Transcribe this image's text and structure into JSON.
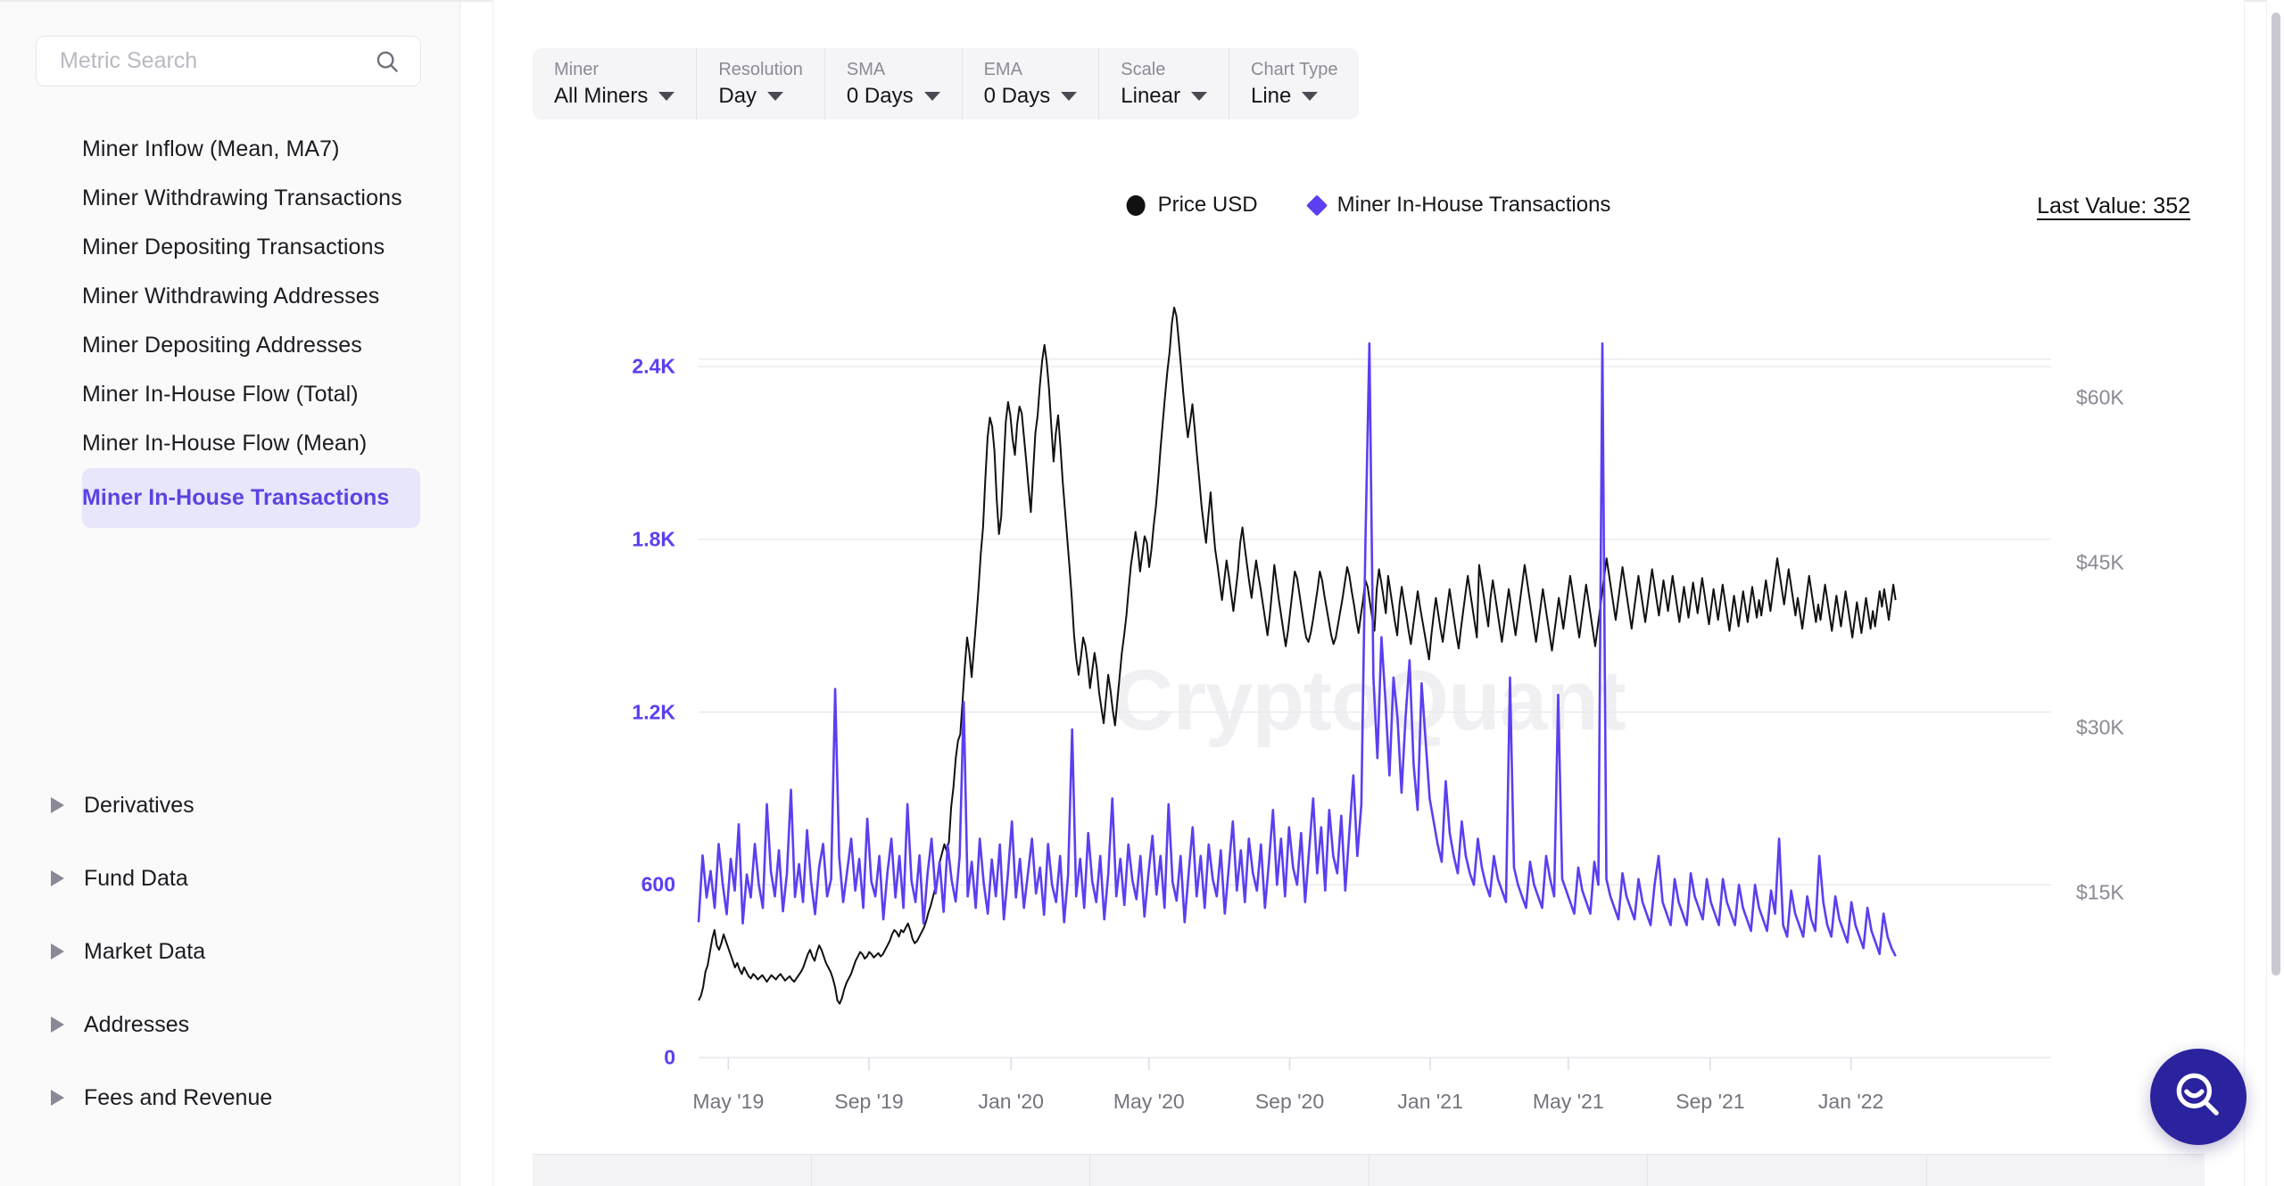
{
  "sidebar": {
    "search": {
      "placeholder": "Metric Search",
      "value": "",
      "icon": "search-icon"
    },
    "metrics": [
      {
        "label": "Miner Inflow (Mean, MA7)",
        "selected": false
      },
      {
        "label": "Miner Withdrawing Transactions",
        "selected": false
      },
      {
        "label": "Miner Depositing Transactions",
        "selected": false
      },
      {
        "label": "Miner Withdrawing Addresses",
        "selected": false
      },
      {
        "label": "Miner Depositing Addresses",
        "selected": false
      },
      {
        "label": "Miner In-House Flow (Total)",
        "selected": false
      },
      {
        "label": "Miner In-House Flow (Mean)",
        "selected": false
      },
      {
        "label": "Miner In-House Transactions",
        "selected": true
      }
    ],
    "groups": [
      {
        "label": "Derivatives",
        "icon": "caret-right-icon",
        "expanded": false
      },
      {
        "label": "Fund Data",
        "icon": "caret-right-icon",
        "expanded": false
      },
      {
        "label": "Market Data",
        "icon": "caret-right-icon",
        "expanded": false
      },
      {
        "label": "Addresses",
        "icon": "caret-right-icon",
        "expanded": false
      },
      {
        "label": "Fees and Revenue",
        "icon": "caret-right-icon",
        "expanded": false
      }
    ],
    "selected_color": "#5a43e3",
    "selected_bg": "#e8e6fb"
  },
  "controls": [
    {
      "label": "Miner",
      "value": "All Miners",
      "icon": "chevron-down-icon"
    },
    {
      "label": "Resolution",
      "value": "Day",
      "icon": "chevron-down-icon"
    },
    {
      "label": "SMA",
      "value": "0 Days",
      "icon": "chevron-down-icon"
    },
    {
      "label": "EMA",
      "value": "0 Days",
      "icon": "chevron-down-icon"
    },
    {
      "label": "Scale",
      "value": "Linear",
      "icon": "chevron-down-icon"
    },
    {
      "label": "Chart Type",
      "value": "Line",
      "icon": "chevron-down-icon"
    }
  ],
  "legend": {
    "entries": [
      {
        "label": "Price USD",
        "marker": "circle",
        "color": "#111114"
      },
      {
        "label": "Miner In-House Transactions",
        "marker": "diamond",
        "color": "#5b3ff0"
      }
    ],
    "last_value": "Last Value: 352"
  },
  "watermark": "CryptoQuant",
  "fab": {
    "icon": "search-smile-icon",
    "color": "#2b229e"
  },
  "chart_data": {
    "type": "line",
    "title": "",
    "subtitle": "",
    "xlabel": "",
    "grid": true,
    "legend_position": "top-center",
    "x_ticks": [
      "May '19",
      "Sep '19",
      "Jan '20",
      "May '20",
      "Sep '20",
      "Jan '21",
      "May '21",
      "Sep '21",
      "Jan '22"
    ],
    "x_tick_positions": [
      0.022,
      0.126,
      0.231,
      0.333,
      0.437,
      0.541,
      0.643,
      0.748,
      0.852
    ],
    "axes": {
      "left": {
        "label": "Miner In-House Transactions",
        "color": "#5b3ff0",
        "ticks": [
          "0",
          "600",
          "1.2K",
          "1.8K",
          "2.4K"
        ],
        "tick_values": [
          0,
          600,
          1200,
          1800,
          2400
        ],
        "ylim": [
          0,
          2750
        ]
      },
      "right": {
        "label": "Price USD",
        "color": "#8a8a96",
        "ticks": [
          "$15K",
          "$30K",
          "$45K",
          "$60K"
        ],
        "tick_values": [
          15000,
          30000,
          45000,
          60000
        ],
        "ylim": [
          0,
          72000
        ]
      }
    },
    "series": [
      {
        "name": "Miner In-House Transactions",
        "color": "#5b3ff0",
        "axis": "left",
        "values": [
          470,
          702,
          556,
          648,
          520,
          742,
          604,
          498,
          690,
          580,
          810,
          466,
          636,
          556,
          742,
          600,
          520,
          880,
          646,
          560,
          720,
          508,
          640,
          930,
          558,
          672,
          540,
          790,
          612,
          498,
          660,
          742,
          560,
          620,
          1280,
          700,
          540,
          648,
          760,
          580,
          690,
          520,
          830,
          612,
          560,
          700,
          480,
          640,
          760,
          556,
          700,
          520,
          880,
          614,
          540,
          702,
          466,
          638,
          760,
          570,
          680,
          506,
          740,
          616,
          542,
          700,
          1235,
          560,
          680,
          520,
          760,
          604,
          500,
          688,
          560,
          740,
          480,
          636,
          820,
          556,
          690,
          520,
          640,
          760,
          570,
          660,
          496,
          742,
          600,
          540,
          700,
          470,
          636,
          1140,
          560,
          690,
          520,
          780,
          612,
          540,
          700,
          480,
          640,
          900,
          560,
          690,
          530,
          740,
          616,
          550,
          700,
          490,
          640,
          770,
          566,
          700,
          520,
          880,
          610,
          545,
          700,
          470,
          640,
          800,
          560,
          700,
          520,
          740,
          620,
          560,
          720,
          500,
          660,
          820,
          580,
          720,
          540,
          760,
          640,
          580,
          740,
          520,
          680,
          860,
          600,
          760,
          560,
          800,
          660,
          600,
          780,
          540,
          720,
          900,
          640,
          800,
          580,
          860,
          700,
          640,
          840,
          580,
          780,
          980,
          700,
          880,
          1780,
          2480,
          1320,
          1040,
          1460,
          1240,
          980,
          1320,
          1180,
          920,
          1180,
          1380,
          1020,
          860,
          1300,
          1100,
          900,
          820,
          740,
          680,
          960,
          780,
          700,
          640,
          820,
          700,
          640,
          600,
          760,
          660,
          600,
          560,
          700,
          620,
          580,
          540,
          1320,
          660,
          600,
          560,
          520,
          680,
          600,
          560,
          520,
          700,
          620,
          560,
          1260,
          620,
          580,
          540,
          500,
          660,
          580,
          540,
          500,
          680,
          600,
          2480,
          620,
          560,
          520,
          480,
          640,
          560,
          520,
          480,
          620,
          540,
          500,
          460,
          600,
          700,
          540,
          500,
          460,
          620,
          540,
          500,
          460,
          640,
          560,
          520,
          480,
          620,
          540,
          500,
          460,
          620,
          540,
          500,
          460,
          600,
          520,
          480,
          440,
          600,
          520,
          480,
          440,
          580,
          500,
          760,
          460,
          420,
          580,
          500,
          460,
          420,
          560,
          480,
          440,
          700,
          540,
          460,
          420,
          560,
          480,
          440,
          400,
          540,
          460,
          420,
          380,
          520,
          440,
          400,
          360,
          500,
          420,
          380,
          352
        ]
      },
      {
        "name": "Price USD",
        "color": "#111114",
        "axis": "right",
        "values": [
          5200,
          5600,
          6400,
          7800,
          8400,
          9600,
          10800,
          11600,
          10200,
          9800,
          10400,
          11200,
          10600,
          10000,
          9400,
          8800,
          8200,
          8600,
          8000,
          7600,
          8200,
          7800,
          7400,
          7200,
          7600,
          7400,
          7100,
          7300,
          7500,
          7200,
          6900,
          7200,
          7500,
          7300,
          7100,
          7400,
          7600,
          7300,
          7000,
          7200,
          7400,
          7100,
          6900,
          7200,
          7500,
          7800,
          8200,
          8800,
          9400,
          9800,
          9200,
          8800,
          9600,
          10200,
          9800,
          9200,
          8600,
          8200,
          7800,
          7200,
          6400,
          5200,
          4900,
          5400,
          6200,
          6800,
          7200,
          7600,
          8200,
          8800,
          9200,
          9600,
          9400,
          9000,
          9200,
          9600,
          9400,
          9100,
          9300,
          9500,
          9200,
          9400,
          9800,
          10200,
          10600,
          11200,
          11600,
          11400,
          11000,
          11600,
          11400,
          11800,
          12200,
          11600,
          10800,
          10400,
          10600,
          11000,
          11400,
          11800,
          12400,
          13200,
          13800,
          14600,
          15400,
          16200,
          17800,
          18600,
          19400,
          18800,
          19600,
          22800,
          24600,
          27200,
          28800,
          29400,
          32400,
          35600,
          38200,
          36800,
          34600,
          37200,
          39800,
          42600,
          45800,
          48200,
          52600,
          56400,
          58200,
          57400,
          55200,
          50800,
          47600,
          49200,
          53600,
          57800,
          59600,
          58400,
          56200,
          54800,
          57600,
          59200,
          58600,
          56400,
          54200,
          51800,
          49600,
          53200,
          56800,
          58400,
          61200,
          63400,
          64800,
          63200,
          60800,
          57400,
          54200,
          56800,
          58400,
          55600,
          52400,
          49800,
          47200,
          44600,
          41800,
          38400,
          36200,
          34800,
          36400,
          38200,
          37400,
          35800,
          33600,
          35200,
          36800,
          35400,
          33200,
          31800,
          30400,
          32600,
          34800,
          33400,
          31600,
          30200,
          32400,
          34600,
          36800,
          38400,
          40200,
          42600,
          44800,
          46200,
          47800,
          46400,
          44200,
          45800,
          47400,
          46800,
          44600,
          46200,
          48400,
          50200,
          52600,
          55400,
          57800,
          60200,
          62400,
          64200,
          66800,
          68200,
          67400,
          65200,
          62800,
          60400,
          58200,
          56400,
          57800,
          59400,
          57200,
          54800,
          52600,
          50200,
          48400,
          46800,
          49200,
          51400,
          48600,
          46200,
          44800,
          43200,
          41600,
          43400,
          45200,
          43800,
          42200,
          40600,
          42400,
          44200,
          46800,
          48200,
          46400,
          44800,
          43200,
          41800,
          43600,
          45200,
          43800,
          42600,
          41200,
          39800,
          38400,
          40200,
          42400,
          44800,
          43200,
          41600,
          40200,
          38800,
          37400,
          38800,
          40600,
          42400,
          44200,
          43600,
          42200,
          40800,
          39400,
          38200,
          37800,
          38600,
          39800,
          41200,
          42600,
          44200,
          43400,
          42000,
          40800,
          39600,
          38400,
          37600,
          38200,
          39400,
          40600,
          41800,
          43200,
          44600,
          43800,
          42400,
          41200,
          39800,
          38600,
          40200,
          41600,
          43400,
          42800,
          41400,
          40000,
          38800,
          42600,
          44400,
          43200,
          41800,
          40400,
          43800,
          42400,
          41000,
          39600,
          38400,
          41200,
          42800,
          41400,
          40200,
          38800,
          37600,
          39200,
          40800,
          42400,
          41000,
          39800,
          38600,
          37400,
          36200,
          38400,
          40200,
          41800,
          40400,
          39000,
          37800,
          39400,
          41000,
          42600,
          41200,
          39800,
          38400,
          37200,
          39000,
          40600,
          42200,
          43800,
          42400,
          41000,
          39600,
          38200,
          44800,
          43400,
          42000,
          40600,
          39200,
          41800,
          43400,
          42000,
          40600,
          39200,
          37800,
          39400,
          41000,
          42600,
          41200,
          39800,
          38400,
          40000,
          41600,
          43200,
          44800,
          43400,
          42000,
          40600,
          39200,
          37800,
          39400,
          41000,
          42600,
          41200,
          39800,
          38400,
          37000,
          38600,
          40200,
          41800,
          40400,
          39000,
          40600,
          42200,
          43800,
          42400,
          41000,
          39600,
          38200,
          39800,
          41400,
          43000,
          41600,
          40200,
          38800,
          37400,
          39000,
          40600,
          42200,
          43800,
          45400,
          44000,
          42600,
          41200,
          39800,
          41400,
          43000,
          44600,
          43200,
          41800,
          40400,
          39000,
          40600,
          42200,
          43800,
          42400,
          41000,
          39600,
          41200,
          42800,
          44400,
          43000,
          41600,
          40200,
          41800,
          43400,
          42000,
          40600,
          42200,
          43800,
          42400,
          41000,
          39600,
          41200,
          42800,
          41400,
          40000,
          41600,
          43200,
          41800,
          40400,
          42000,
          43600,
          42200,
          40800,
          39400,
          41000,
          42600,
          41200,
          39800,
          41400,
          43000,
          41600,
          40200,
          38800,
          40400,
          42000,
          40600,
          39200,
          40800,
          42400,
          41000,
          39600,
          41200,
          42800,
          41400,
          40000,
          41600,
          40200,
          41800,
          43400,
          42000,
          40600,
          42200,
          43800,
          45400,
          44000,
          42600,
          41200,
          42800,
          44400,
          43000,
          41600,
          40200,
          41800,
          40400,
          39000,
          40600,
          42200,
          43800,
          42400,
          41000,
          39600,
          41200,
          39800,
          41400,
          43000,
          41600,
          40200,
          38800,
          40400,
          42000,
          40600,
          39200,
          40800,
          42400,
          41000,
          39600,
          38200,
          39800,
          41400,
          40000,
          38600,
          40200,
          41800,
          40400,
          39000,
          40600,
          39200,
          40800,
          42400,
          41000,
          42600,
          41200,
          39800,
          41400,
          43000,
          41600
        ]
      }
    ]
  }
}
